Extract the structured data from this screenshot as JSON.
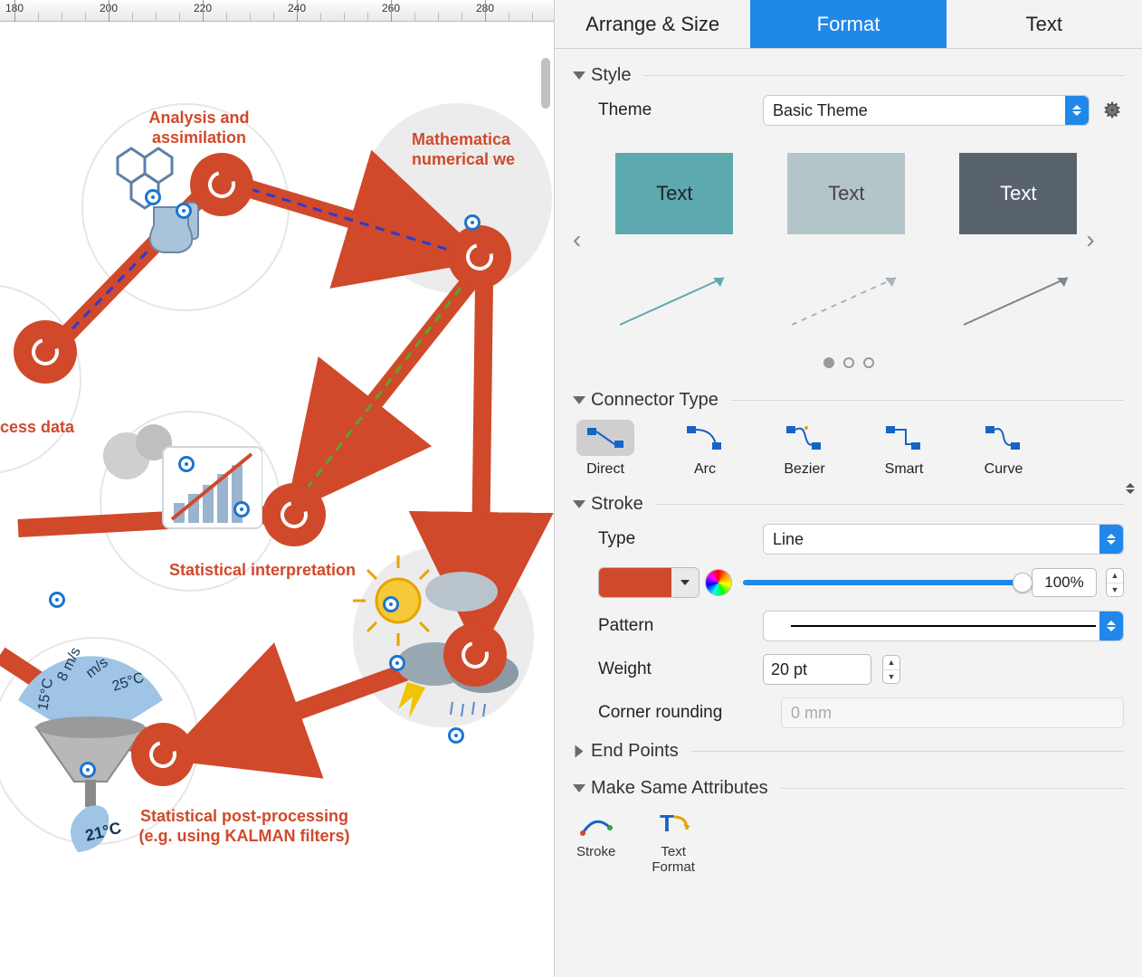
{
  "ruler": {
    "marks": [
      180,
      200,
      220,
      240,
      260,
      280
    ]
  },
  "canvas": {
    "labels": {
      "analysis": "Analysis and\nassimilation",
      "math": "Mathematica\nnumerical we",
      "process": "cess data",
      "stat_interp": "Statistical interpretation",
      "stat_post": "Statistical post-processing\n(e.g. using KALMAN filters)"
    },
    "gauge": {
      "l1": "8 m/s",
      "l2": "m/s",
      "l3": "15°C",
      "l4": "25°C",
      "out": "21°C"
    }
  },
  "panel": {
    "tabs": {
      "arrange": "Arrange & Size",
      "format": "Format",
      "text": "Text",
      "active": "format"
    },
    "style": {
      "title": "Style",
      "theme_label": "Theme",
      "theme_value": "Basic Theme",
      "swatch_text": "Text"
    },
    "connector": {
      "title": "Connector Type",
      "items": [
        "Direct",
        "Arc",
        "Bezier",
        "Smart",
        "Curve"
      ],
      "selected": 0
    },
    "stroke": {
      "title": "Stroke",
      "type_label": "Type",
      "type_value": "Line",
      "color": "#d0492b",
      "opacity": "100%",
      "pattern_label": "Pattern",
      "weight_label": "Weight",
      "weight_value": "20 pt",
      "corner_label": "Corner rounding",
      "corner_placeholder": "0 mm"
    },
    "endpoints": {
      "title": "End Points"
    },
    "sameattr": {
      "title": "Make Same Attributes",
      "items": [
        "Stroke",
        "Text\nFormat"
      ]
    }
  }
}
